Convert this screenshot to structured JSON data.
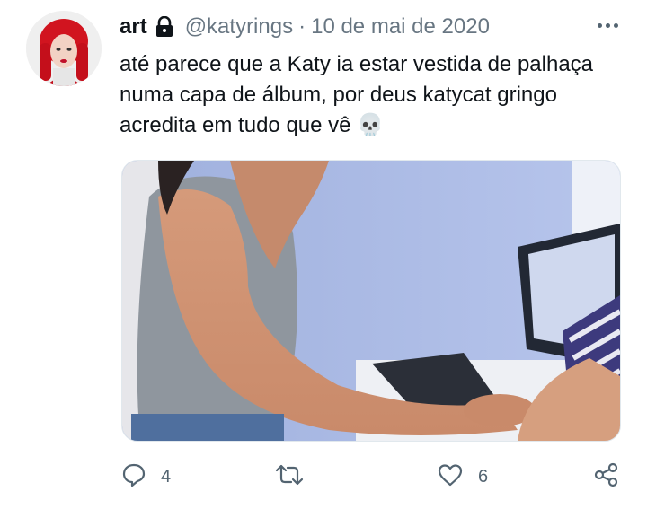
{
  "tweet": {
    "display_name": "art",
    "handle": "@katyrings",
    "separator": "·",
    "date": "10 de mai de 2020",
    "text_lines": [
      "até parece que a Katy ia estar vestida de palhaça",
      "numa capa de álbum, por deus katycat gringo",
      "acredita em tudo que vê 💀"
    ]
  },
  "actions": {
    "reply_count": "4",
    "like_count": "6"
  },
  "icons": {
    "lock": "lock-icon",
    "more": "more-options-icon",
    "reply": "reply-icon",
    "retweet": "retweet-icon",
    "like": "heart-icon",
    "share": "share-icon"
  },
  "colors": {
    "text": "#0f1419",
    "secondary": "#687682",
    "icon": "#536471"
  }
}
